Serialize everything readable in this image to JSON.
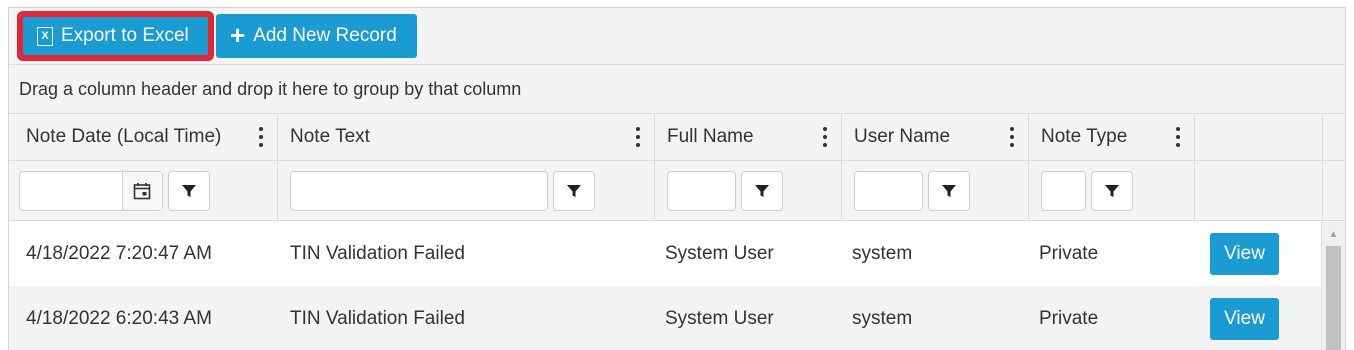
{
  "toolbar": {
    "export_label": "Export to Excel",
    "add_label": "Add New Record"
  },
  "group_bar": {
    "text": "Drag a column header and drop it here to group by that column"
  },
  "columns": [
    {
      "label": "Note Date (Local Time)"
    },
    {
      "label": "Note Text"
    },
    {
      "label": "Full Name"
    },
    {
      "label": "User Name"
    },
    {
      "label": "Note Type"
    }
  ],
  "rows": [
    {
      "note_date": "4/18/2022 7:20:47 AM",
      "note_text": "TIN Validation Failed",
      "full_name": "System User",
      "user_name": "system",
      "note_type": "Private",
      "action": "View"
    },
    {
      "note_date": "4/18/2022 6:20:43 AM",
      "note_text": "TIN Validation Failed",
      "full_name": "System User",
      "user_name": "system",
      "note_type": "Private",
      "action": "View"
    }
  ],
  "icons": {
    "export": "excel-file-icon",
    "add": "plus-icon",
    "calendar": "calendar-icon",
    "filter": "filter-icon",
    "column_menu": "kebab-menu-icon"
  },
  "colors": {
    "primary_button": "#1a9bd2",
    "highlight_border": "#e32634"
  }
}
